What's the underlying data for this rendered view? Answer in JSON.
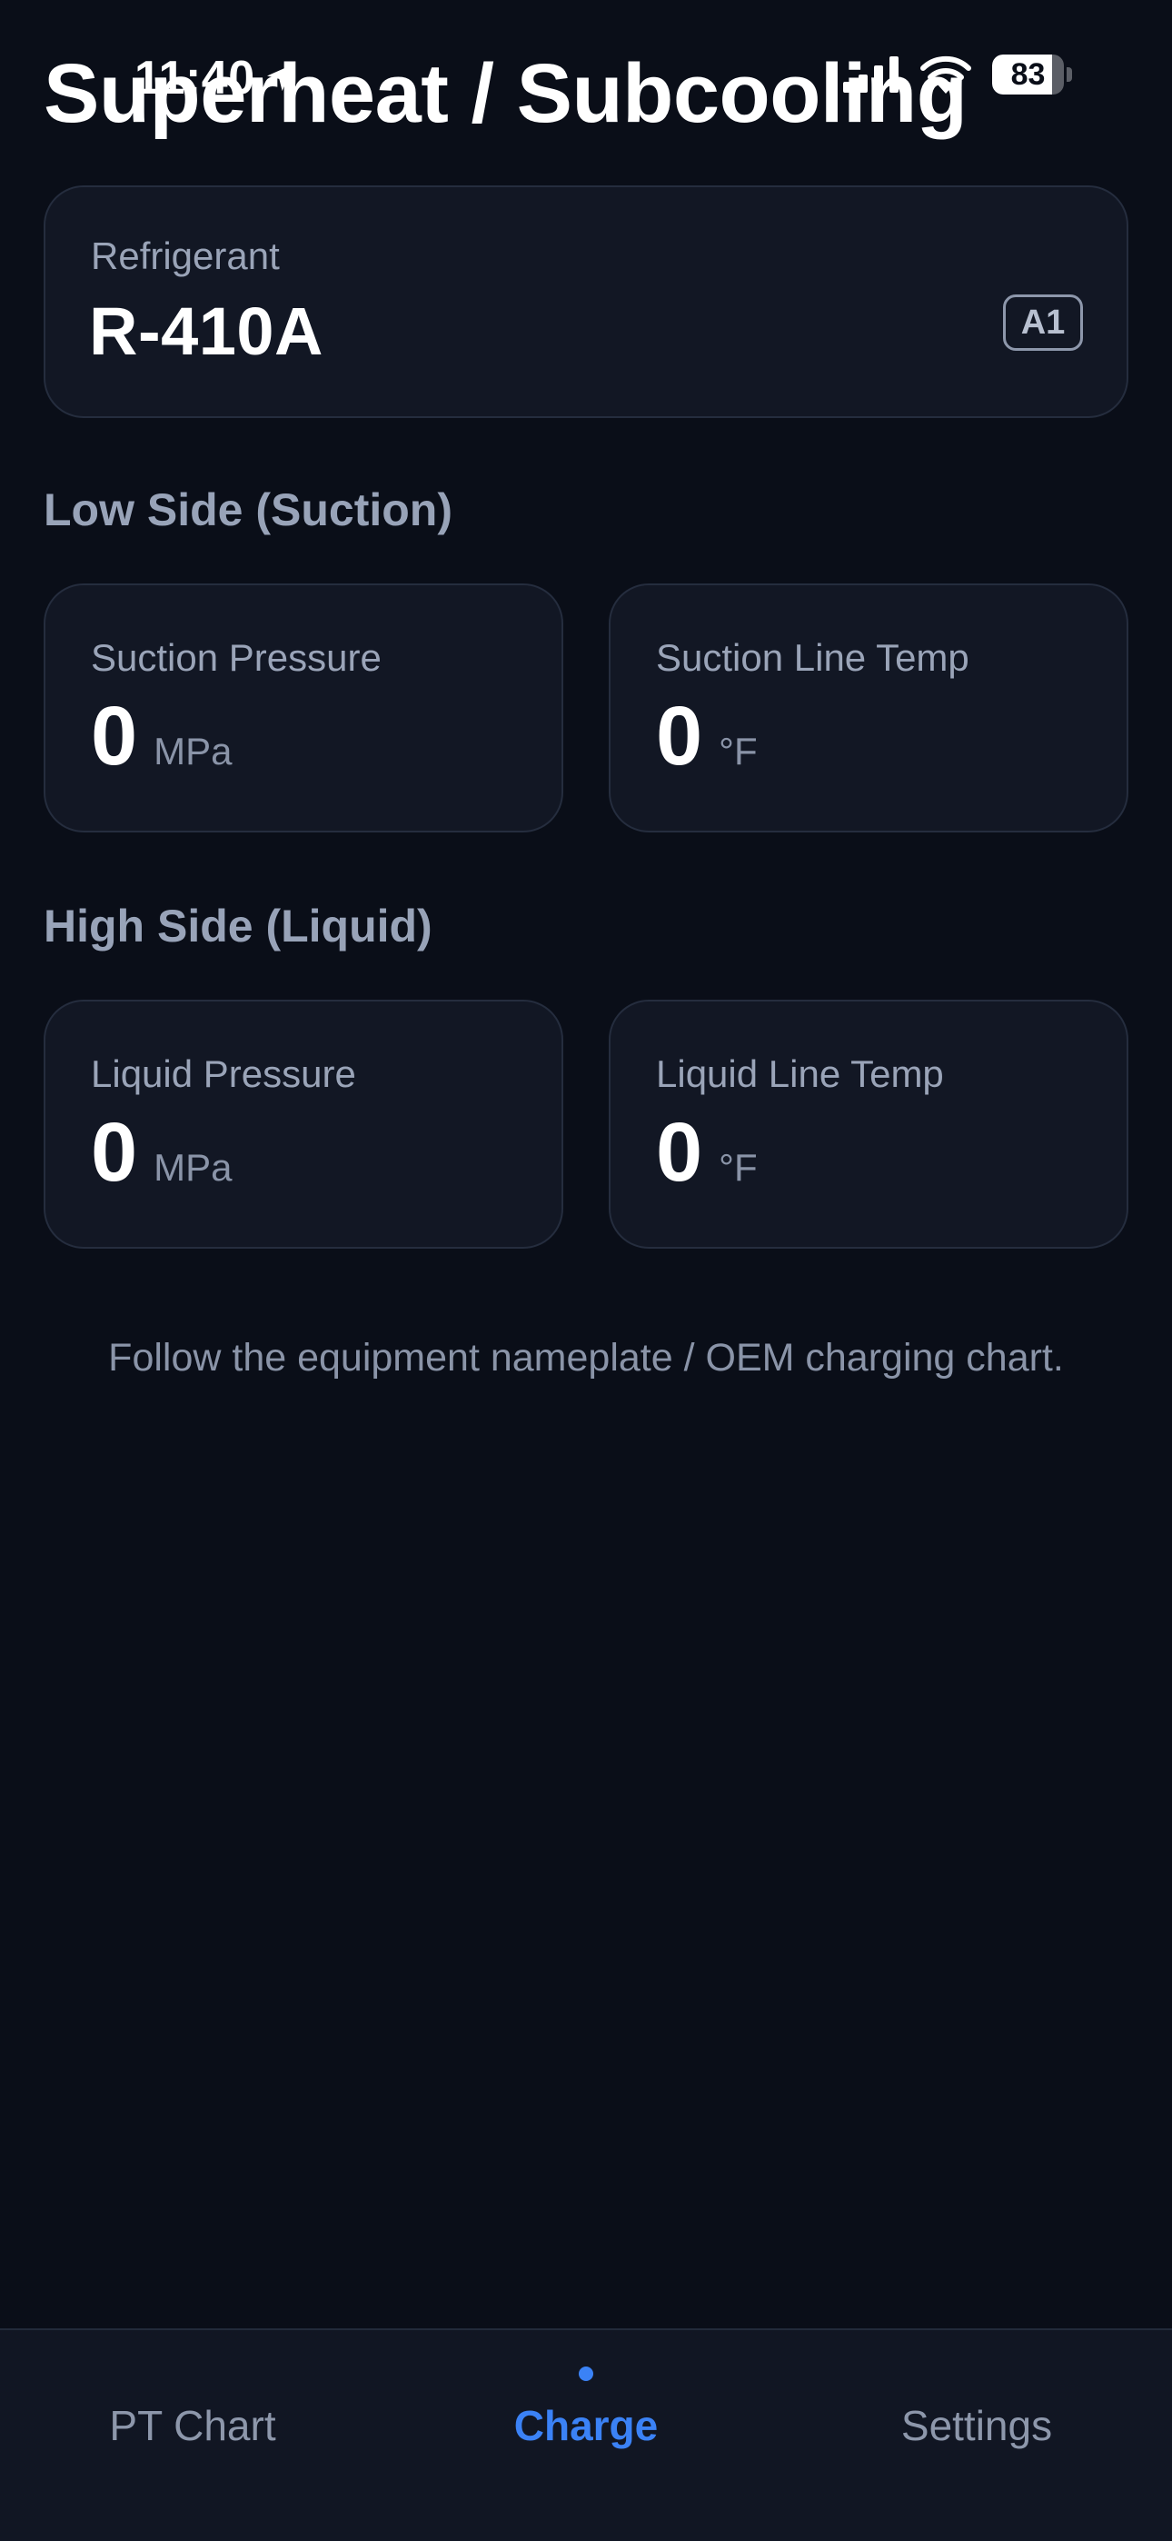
{
  "status_bar": {
    "time": "11:40",
    "battery_percent": 83,
    "battery_label": "83",
    "icons": [
      "location-arrow-icon",
      "cellular-signal-icon",
      "wifi-icon",
      "battery-icon"
    ]
  },
  "header": {
    "title": "Superheat / Subcooling"
  },
  "refrigerant": {
    "label": "Refrigerant",
    "value": "R-410A",
    "safety_class": "A1"
  },
  "low_side": {
    "title": "Low Side (Suction)",
    "pressure": {
      "label": "Suction Pressure",
      "value": "0",
      "unit": "MPa"
    },
    "temperature": {
      "label": "Suction Line Temp",
      "value": "0",
      "unit": "°F"
    }
  },
  "high_side": {
    "title": "High Side (Liquid)",
    "pressure": {
      "label": "Liquid Pressure",
      "value": "0",
      "unit": "MPa"
    },
    "temperature": {
      "label": "Liquid Line Temp",
      "value": "0",
      "unit": "°F"
    }
  },
  "footnote": "Follow the equipment nameplate / OEM charging chart.",
  "tabs": [
    {
      "label": "PT Chart",
      "active": false
    },
    {
      "label": "Charge",
      "active": true
    },
    {
      "label": "Settings",
      "active": false
    }
  ],
  "colors": {
    "background": "#0a0e18",
    "card": "#121724",
    "accent": "#3b82f6",
    "muted_text": "#8a94a8"
  }
}
